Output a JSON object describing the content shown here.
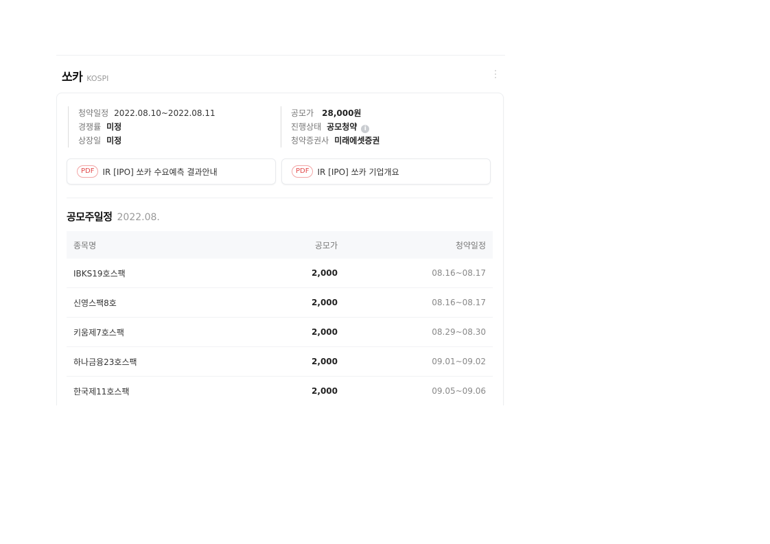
{
  "header": {
    "title": "쏘카",
    "market": "KOSPI"
  },
  "info": {
    "left": [
      {
        "label": "청약일정",
        "value": "2022.08.10~2022.08.11"
      },
      {
        "label": "경쟁률",
        "value": "미정"
      },
      {
        "label": "상장일",
        "value": "미정"
      }
    ],
    "right": [
      {
        "label": "공모가",
        "value": "28,000원"
      },
      {
        "label": "진행상태",
        "value": "공모청약"
      },
      {
        "label": "청약증권사",
        "value": "미래에셋증권"
      }
    ]
  },
  "documents": [
    {
      "badge": "PDF",
      "title": "IR [IPO] 쏘카 수요예측 결과안내"
    },
    {
      "badge": "PDF",
      "title": "IR [IPO] 쏘카 기업개요"
    }
  ],
  "schedule": {
    "title": "공모주일정",
    "month": "2022.08.",
    "columns": [
      "종목명",
      "공모가",
      "청약일정"
    ],
    "rows": [
      [
        "IBKS19호스팩",
        "2,000",
        "08.16~08.17"
      ],
      [
        "신영스팩8호",
        "2,000",
        "08.16~08.17"
      ],
      [
        "키움제7호스팩",
        "2,000",
        "08.29~08.30"
      ],
      [
        "하나금융23호스팩",
        "2,000",
        "09.01~09.02"
      ],
      [
        "한국제11호스팩",
        "2,000",
        "09.05~09.06"
      ]
    ]
  },
  "icons": {
    "more": "more-vertical-icon",
    "info": "info-icon"
  },
  "colors": {
    "pdf_accent": "#e2494a"
  }
}
